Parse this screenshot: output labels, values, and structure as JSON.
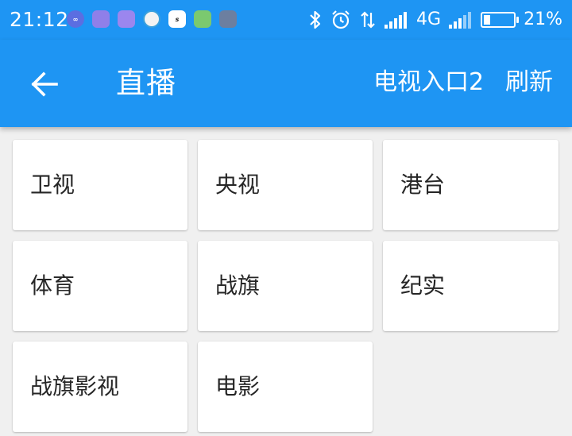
{
  "status_bar": {
    "time": "21:12",
    "network": "4G",
    "battery": "21%",
    "battery_level": 0.21,
    "notification_icons": [
      "infinity-app-icon",
      "apk-icon",
      "apk-icon",
      "browser-icon",
      "sina-icon",
      "map-icon",
      "phone-icon"
    ],
    "status_icons": [
      "bluetooth-icon",
      "alarm-icon",
      "data-transfer-icon",
      "signal-icon",
      "signal-icon",
      "battery-icon"
    ]
  },
  "appbar": {
    "title": "直播",
    "back_icon": "arrow-left-icon",
    "actions": {
      "tv_entry": "电视入口2",
      "refresh": "刷新"
    }
  },
  "categories": [
    {
      "label": "卫视"
    },
    {
      "label": "央视"
    },
    {
      "label": "港台"
    },
    {
      "label": "体育"
    },
    {
      "label": "战旗"
    },
    {
      "label": "纪实"
    },
    {
      "label": "战旗影视"
    },
    {
      "label": "电影"
    }
  ],
  "colors": {
    "primary": "#1e95f3",
    "background": "#f0f0f0",
    "card": "#ffffff",
    "text": "#262626"
  }
}
